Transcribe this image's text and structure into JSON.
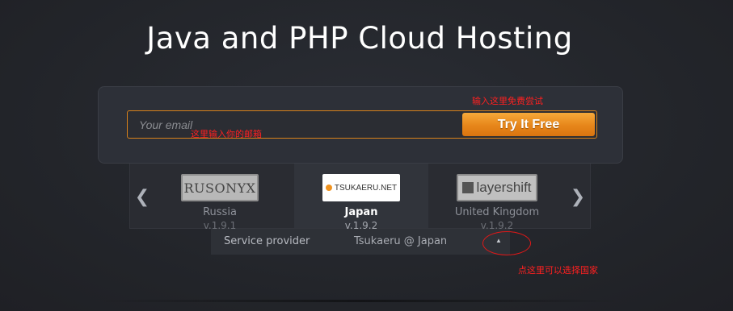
{
  "header": {
    "title": "Java and PHP Cloud Hosting"
  },
  "signup": {
    "email_placeholder": "Your email",
    "button_label": "Try It Free"
  },
  "annotations": {
    "try_hint": "输入这里免费尝试",
    "email_hint": "这里输入你的邮箱",
    "country_hint": "点这里可以选择国家"
  },
  "carousel": {
    "prev_icon": "chevron-left-icon",
    "next_icon": "chevron-right-icon",
    "providers": [
      {
        "logo": "RUSONYX",
        "country": "Russia",
        "version": "v.1.9.1"
      },
      {
        "logo": "TSUKAERU.NET",
        "country": "Japan",
        "version": "v.1.9.2",
        "selected": true
      },
      {
        "logo": "layershift",
        "country": "United Kingdom",
        "version": "v.1.9.2"
      }
    ]
  },
  "service": {
    "label": "Service provider",
    "value": "Tsukaeru @ Japan",
    "toggle_icon": "caret-up-icon"
  },
  "colors": {
    "background": "#23252b",
    "accent": "#e7861a",
    "annotation": "#ff2020"
  }
}
